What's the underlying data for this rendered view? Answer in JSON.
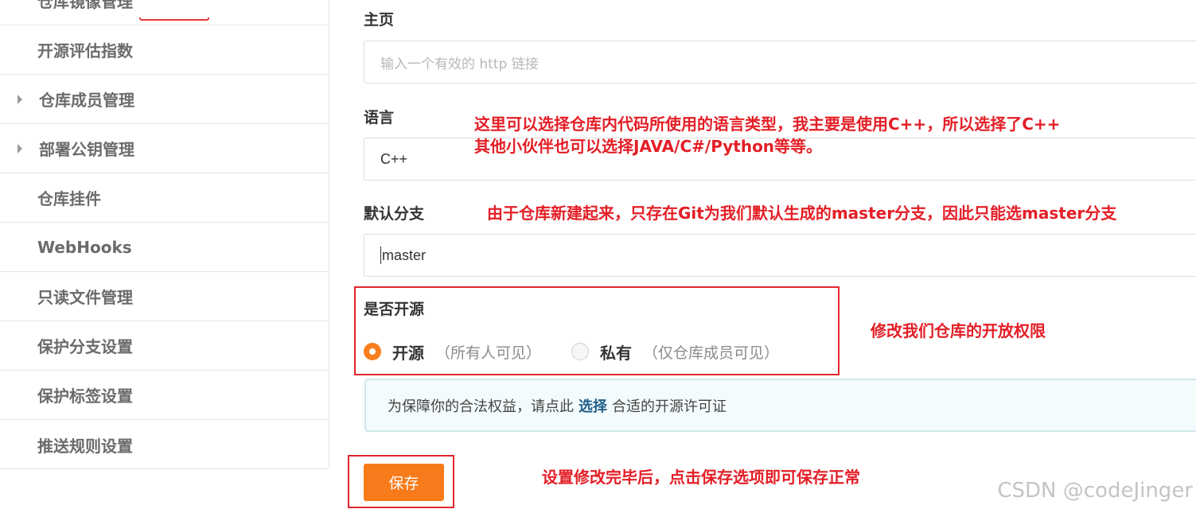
{
  "sidebar": {
    "items": [
      {
        "label": "仓库镜像管理",
        "caret": false
      },
      {
        "label": "开源评估指数",
        "caret": false
      },
      {
        "label": "仓库成员管理",
        "caret": true
      },
      {
        "label": "部署公钥管理",
        "caret": true
      },
      {
        "label": "仓库挂件",
        "caret": false
      },
      {
        "label": "WebHooks",
        "caret": false
      },
      {
        "label": "只读文件管理",
        "caret": false
      },
      {
        "label": "保护分支设置",
        "caret": false
      },
      {
        "label": "保护标签设置",
        "caret": false
      },
      {
        "label": "推送规则设置",
        "caret": false
      }
    ]
  },
  "form": {
    "homepage": {
      "label": "主页",
      "placeholder": "输入一个有效的 http 链接"
    },
    "language": {
      "label": "语言",
      "value": "C++"
    },
    "branch": {
      "label": "默认分支",
      "value": "master"
    },
    "open_source": {
      "label": "是否开源",
      "options": [
        {
          "label": "开源",
          "hint": "（所有人可见）",
          "selected": true
        },
        {
          "label": "私有",
          "hint": "（仅仓库成员可见）",
          "selected": false
        }
      ]
    },
    "license_notice": {
      "prefix": "为保障你的合法权益，请点此",
      "link": "选择",
      "suffix": "合适的开源许可证"
    },
    "save_label": "保存"
  },
  "annotations": {
    "language_line1": "这里可以选择仓库内代码所使用的语言类型，我主要是使用C++，所以选择了C++",
    "language_line2": "其他小伙伴也可以选择JAVA/C#/Python等等。",
    "branch": "由于仓库新建起来，只存在Git为我们默认生成的master分支，因此只能选master分支",
    "open_source": "修改我们仓库的开放权限",
    "save": "设置修改完毕后，点击保存选项即可保存正常"
  },
  "watermark": "CSDN @codeJinger",
  "colors": {
    "accent": "#f77b1a",
    "annotation": "#e41e26",
    "link": "#1f5f8a"
  }
}
